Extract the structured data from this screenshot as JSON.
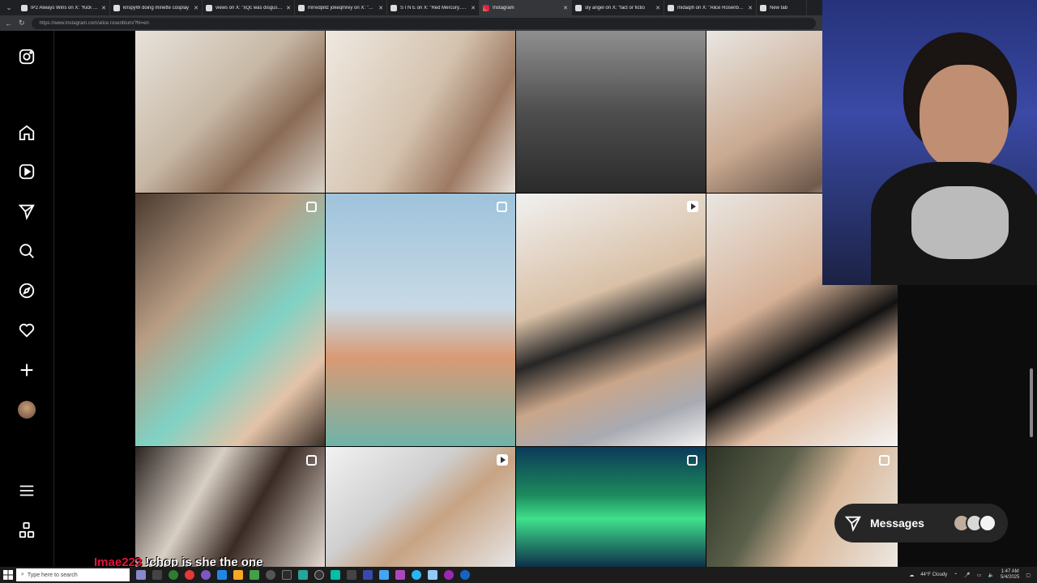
{
  "browser": {
    "tabs": [
      {
        "title": "IP2 Always Wins on X: \"Kick Stre",
        "active": false
      },
      {
        "title": "krispyW doing minette cosplay",
        "active": false
      },
      {
        "title": "views on X: \"xQc was disgusted",
        "active": false
      },
      {
        "title": "mrredpillz jokeqmrey on X: \"Con",
        "active": false
      },
      {
        "title": "S I N E on X: \"Red Mercury... htt",
        "active": false
      },
      {
        "title": "Instagram",
        "active": true
      },
      {
        "title": "sly angel on X: \"fact or fictio",
        "active": false
      },
      {
        "title": "midaqih on X: \"Alice Rosenblum",
        "active": false
      },
      {
        "title": "New tab",
        "active": false
      }
    ],
    "url": "https://www.instagram.com/alice.rosenblum/?hl=en"
  },
  "messages": {
    "label": "Messages"
  },
  "chat": {
    "user": "Imae223",
    "message": "!chop is she the one"
  },
  "taskbar": {
    "search_placeholder": "Type here to search",
    "weather": "44°F  Cloudy",
    "time": "1:47 AM",
    "date": "5/4/2025"
  },
  "colors": {
    "accent_chat_user": "#e0143c",
    "instagram_bg": "#000000"
  }
}
